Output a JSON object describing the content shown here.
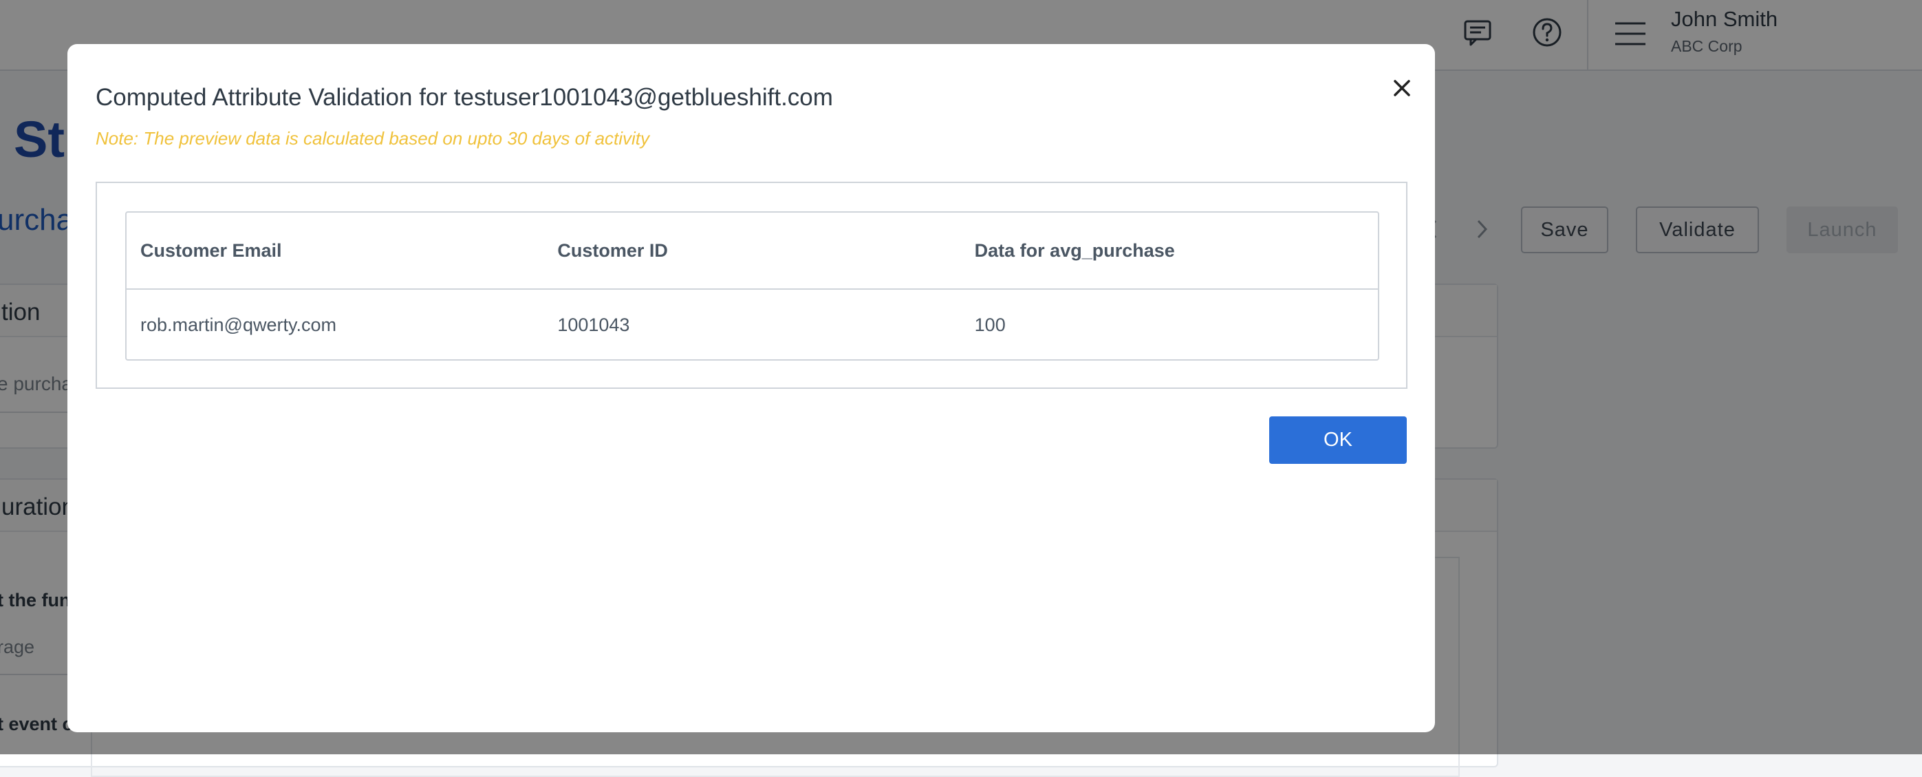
{
  "header": {
    "user_name": "John Smith",
    "user_org": "ABC Corp",
    "icons": [
      "chat-icon",
      "help-icon",
      "menu-icon"
    ]
  },
  "background": {
    "page_title_fragment": "St",
    "page_subtitle_fragment": "urcha",
    "toolbar": {
      "save": "Save",
      "validate": "Validate",
      "launch": "Launch"
    },
    "section1_title_fragment": "tion",
    "section1_field_fragment": "e purcha",
    "section2_title_fragment": "uration",
    "section2_label_fragment": "t the fun",
    "section2_value_fragment": "rage",
    "section2_label2_fragment": "t event c"
  },
  "modal": {
    "title": "Computed Attribute Validation for testuser1001043@getblueshift.com",
    "note": "Note: The preview data is calculated based on upto 30 days of activity",
    "table": {
      "headers": [
        "Customer Email",
        "Customer ID",
        "Data for avg_purchase"
      ],
      "rows": [
        [
          "rob.martin@qwerty.com",
          "1001043",
          "100"
        ]
      ]
    },
    "ok_label": "OK"
  },
  "colors": {
    "primary": "#2b6fd8",
    "note": "#f0c23c",
    "title_blue": "#1f4aa8"
  }
}
